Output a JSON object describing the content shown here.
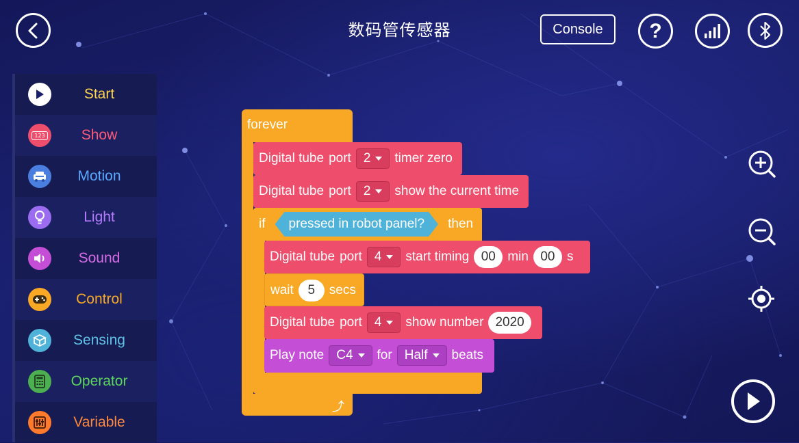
{
  "header": {
    "title": "数码管传感器",
    "console_label": "Console",
    "back_icon": "back-arrow-icon",
    "help_icon": "question-mark-icon",
    "signal_icon": "signal-bars-icon",
    "bluetooth_icon": "bluetooth-icon"
  },
  "sidebar": {
    "items": [
      {
        "label": "Start",
        "icon": "play-icon",
        "color": "#ffd54f",
        "icon_bg": "#ffffff"
      },
      {
        "label": "Show",
        "icon": "display-123-icon",
        "color": "#ff5a78",
        "icon_bg": "#ee4d6c"
      },
      {
        "label": "Motion",
        "icon": "car-icon",
        "color": "#5aa9ff",
        "icon_bg": "#4a7fe0"
      },
      {
        "label": "Light",
        "icon": "bulb-icon",
        "color": "#b57bff",
        "icon_bg": "#9b6cf0"
      },
      {
        "label": "Sound",
        "icon": "speaker-icon",
        "color": "#d86be6",
        "icon_bg": "#c44fd6"
      },
      {
        "label": "Control",
        "icon": "gamepad-icon",
        "color": "#f9a825",
        "icon_bg": "#f9a825"
      },
      {
        "label": "Sensing",
        "icon": "cube-icon",
        "color": "#5fc3e8",
        "icon_bg": "#4fb3d9"
      },
      {
        "label": "Operator",
        "icon": "calculator-icon",
        "color": "#5cd65c",
        "icon_bg": "#4caf50"
      },
      {
        "label": "Variable",
        "icon": "sliders-icon",
        "color": "#ff8a3d",
        "icon_bg": "#ff7a2a"
      }
    ]
  },
  "script": {
    "forever_label": "forever",
    "b1": {
      "t1": "Digital tube",
      "t2": "port",
      "port": "2",
      "t3": "timer zero"
    },
    "b2": {
      "t1": "Digital tube",
      "t2": "port",
      "port": "2",
      "t3": "show the current time"
    },
    "if_block": {
      "if_label": "if",
      "condition": "pressed in robot panel?",
      "then_label": "then"
    },
    "b3": {
      "t1": "Digital tube",
      "t2": "port",
      "port": "4",
      "t3": "start timing",
      "min_value": "00",
      "t4": "min",
      "sec_value": "00",
      "t5": "s"
    },
    "b4": {
      "t1": "wait",
      "value": "5",
      "t2": "secs"
    },
    "b5": {
      "t1": "Digital tube",
      "t2": "port",
      "port": "4",
      "t3": "show number",
      "value": "2020"
    },
    "b6": {
      "t1": "Play note",
      "note": "C4",
      "t2": "for",
      "beat": "Half",
      "t3": "beats"
    }
  },
  "right_controls": {
    "zoom_in_icon": "zoom-in-icon",
    "zoom_out_icon": "zoom-out-icon",
    "recenter_icon": "target-icon",
    "run_icon": "play-icon"
  },
  "colors": {
    "control_block": "#f9a825",
    "show_block": "#ee4d6c",
    "sound_block": "#c44fd6",
    "sensing_block": "#4fb3d9"
  }
}
